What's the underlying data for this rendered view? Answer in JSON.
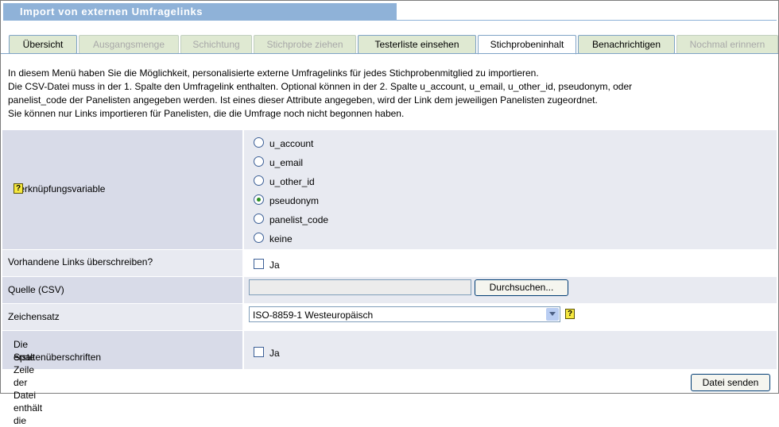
{
  "window_title": "Import von externen Umfragelinks",
  "tabs": [
    {
      "label": "Übersicht",
      "state": "enabled"
    },
    {
      "label": "Ausgangsmenge",
      "state": "disabled"
    },
    {
      "label": "Schichtung",
      "state": "disabled"
    },
    {
      "label": "Stichprobe ziehen",
      "state": "disabled"
    },
    {
      "label": "Testerliste einsehen",
      "state": "enabled"
    },
    {
      "label": "Stichprobeninhalt",
      "state": "active"
    },
    {
      "label": "Benachrichtigen",
      "state": "enabled"
    },
    {
      "label": "Nochmal erinnern",
      "state": "disabled"
    }
  ],
  "intro": {
    "line1": "In diesem Menü haben Sie die Möglichkeit, personalisierte externe Umfragelinks für jedes Stichprobenmitglied zu importieren.",
    "line2": "Die CSV-Datei muss in der 1. Spalte den Umfragelink enthalten. Optional können in der 2. Spalte u_account, u_email, u_other_id, pseudonym, oder",
    "line3": "panelist_code der Panelisten angegeben werden. Ist eines dieser Attribute angegeben, wird der Link dem jeweiligen Panelisten zugeordnet.",
    "line4": "Sie können nur Links importieren für Panelisten, die die Umfrage noch nicht begonnen haben."
  },
  "form": {
    "link_variable": {
      "label": "Verknüpfungsvariable",
      "help_glyph": "?",
      "options": [
        "u_account",
        "u_email",
        "u_other_id",
        "pseudonym",
        "panelist_code",
        "keine"
      ],
      "selected": "pseudonym"
    },
    "overwrite": {
      "label": "Vorhandene Links überschreiben?",
      "checkbox_label": "Ja",
      "checked": false
    },
    "source": {
      "label": "Quelle (CSV)",
      "value": "",
      "browse_label": "Durchsuchen..."
    },
    "charset": {
      "label": "Zeichensatz",
      "value": "ISO-8859-1 Westeuropäisch",
      "help_glyph": "?"
    },
    "header_row": {
      "label_line1": "Die erste Zeile der Datei enthält die",
      "label_line2": "Spaltenüberschriften",
      "checkbox_label": "Ja",
      "checked": false
    }
  },
  "submit_label": "Datei senden",
  "colors": {
    "title_bar": "#8fb2d8",
    "tab_bg": "#dfe9d2",
    "row_dark": "#d8dbe8",
    "row_light": "#e8eaf1",
    "radio_selected": "#2b8f22"
  }
}
